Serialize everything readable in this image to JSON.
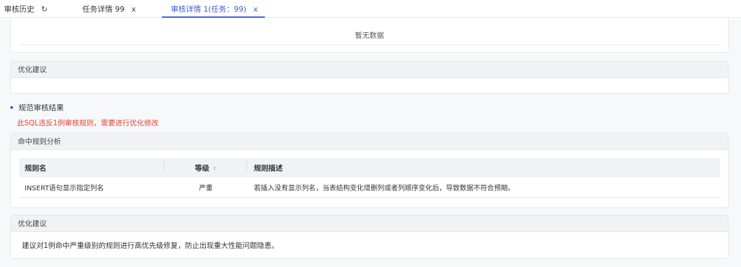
{
  "tabs": [
    {
      "label": "审核历史",
      "icon": "refresh-icon",
      "icon_glyph": "↻"
    },
    {
      "label": "任务详情 99",
      "icon": "close-icon",
      "icon_glyph": "x"
    },
    {
      "label": "审核详情 1(任务：99)",
      "icon": "close-icon",
      "icon_glyph": "x",
      "active": true
    }
  ],
  "top_panel": {
    "empty_text": "暂无数据"
  },
  "optimization_panel_1": {
    "header": "优化建议"
  },
  "audit_result": {
    "title": "规范审核结果",
    "warning": "此SQL违反1例审核规则，需要进行优化修改"
  },
  "rule_analysis": {
    "header": "命中规则分析",
    "columns": [
      "规则名",
      "等级",
      "规则描述"
    ],
    "sort_icon": "sort-icon",
    "rows": [
      {
        "name": "INSERT语句显示指定列名",
        "level": "严重",
        "description": "若插入没有显示列名，当表结构变化增删列或者列顺序变化后，导致数据不符合预期。"
      }
    ]
  },
  "optimization_panel_2": {
    "header": "优化建议",
    "text": "建议对1例命中严重级别的规则进行高优先级修复，防止出现重大性能问题隐患。"
  },
  "colors": {
    "accent": "#3a5bd9",
    "warning": "#e8432e"
  }
}
